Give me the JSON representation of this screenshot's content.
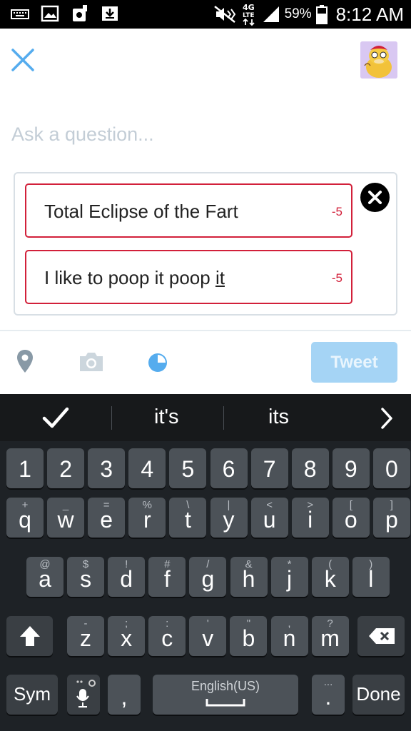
{
  "status_bar": {
    "icons": [
      "keyboard-icon",
      "image-icon",
      "app-notification-icon",
      "download-icon",
      "mute-icon",
      "4g-lte-icon",
      "signal-icon",
      "battery-icon"
    ],
    "battery_text": "59%",
    "time": "8:12 AM"
  },
  "compose": {
    "question_placeholder": "Ask a question...",
    "poll_options": [
      {
        "text_main": "Total Eclipse of the Fart",
        "text_underlined": "",
        "remaining": "-5"
      },
      {
        "text_main": "I like to poop it poop ",
        "text_underlined": "it",
        "remaining": "-5"
      }
    ],
    "tweet_label": "Tweet"
  },
  "keyboard": {
    "suggestions": [
      "it's",
      "its"
    ],
    "number_row": [
      "1",
      "2",
      "3",
      "4",
      "5",
      "6",
      "7",
      "8",
      "9",
      "0"
    ],
    "row1": [
      {
        "k": "q",
        "a": "+"
      },
      {
        "k": "w",
        "a": "_"
      },
      {
        "k": "e",
        "a": "="
      },
      {
        "k": "r",
        "a": "%"
      },
      {
        "k": "t",
        "a": "\\"
      },
      {
        "k": "y",
        "a": "|"
      },
      {
        "k": "u",
        "a": "<"
      },
      {
        "k": "i",
        "a": ">"
      },
      {
        "k": "o",
        "a": "["
      },
      {
        "k": "p",
        "a": "]"
      }
    ],
    "row2": [
      {
        "k": "a",
        "a": "@"
      },
      {
        "k": "s",
        "a": "$"
      },
      {
        "k": "d",
        "a": "!"
      },
      {
        "k": "f",
        "a": "#"
      },
      {
        "k": "g",
        "a": "/"
      },
      {
        "k": "h",
        "a": "&"
      },
      {
        "k": "j",
        "a": "*"
      },
      {
        "k": "k",
        "a": "("
      },
      {
        "k": "l",
        "a": ")"
      }
    ],
    "row3": [
      {
        "k": "z",
        "a": "-"
      },
      {
        "k": "x",
        "a": ";"
      },
      {
        "k": "c",
        "a": ":"
      },
      {
        "k": "v",
        "a": "'"
      },
      {
        "k": "b",
        "a": "\""
      },
      {
        "k": "n",
        "a": ","
      },
      {
        "k": "m",
        "a": "?"
      }
    ],
    "sym_label": "Sym",
    "comma": ",",
    "space_label": "English(US)",
    "period": ".",
    "period_alt": "...",
    "done_label": "Done"
  },
  "colors": {
    "accent": "#55acee",
    "error": "#d2203a",
    "tweet_disabled": "#a5d4f5"
  }
}
